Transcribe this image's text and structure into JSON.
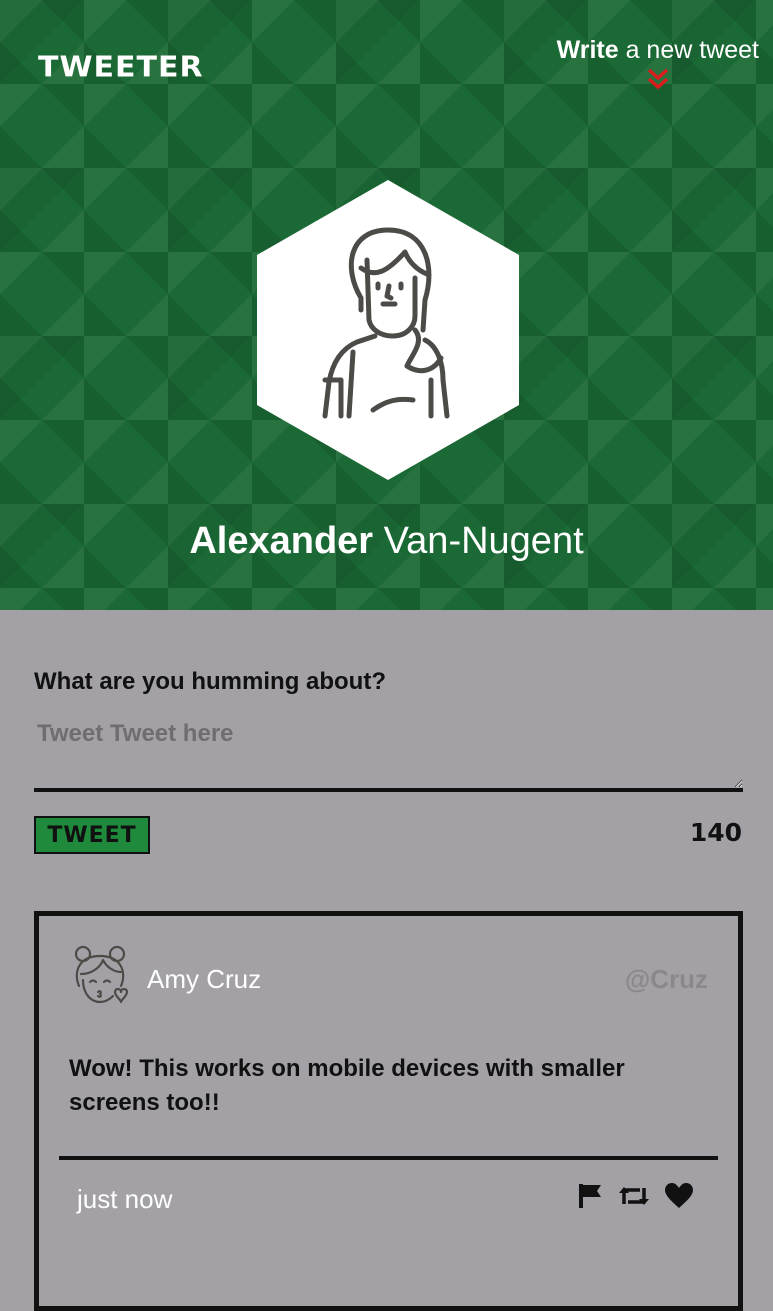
{
  "header": {
    "logo": "TWEETER",
    "compose_toggle": {
      "strong": "Write",
      "rest": " a new tweet"
    },
    "profile": {
      "first_name": "Alexander",
      "last_name": " Van-Nugent"
    }
  },
  "composer": {
    "prompt": "What are you humming about?",
    "placeholder": "Tweet Tweet here",
    "submit_label": "TWEET",
    "char_count": "140"
  },
  "tweets": [
    {
      "name": "Amy Cruz",
      "handle": "@Cruz",
      "text": "Wow! This works on mobile devices with smaller screens too!!",
      "time": "just now",
      "actions": [
        "flag-icon",
        "retweet-icon",
        "heart-icon"
      ]
    }
  ],
  "colors": {
    "header_bg": "#1b6a35",
    "page_bg": "#a4a1a6",
    "accent_red": "#d91c1c",
    "button_green": "#1f8a3c"
  }
}
